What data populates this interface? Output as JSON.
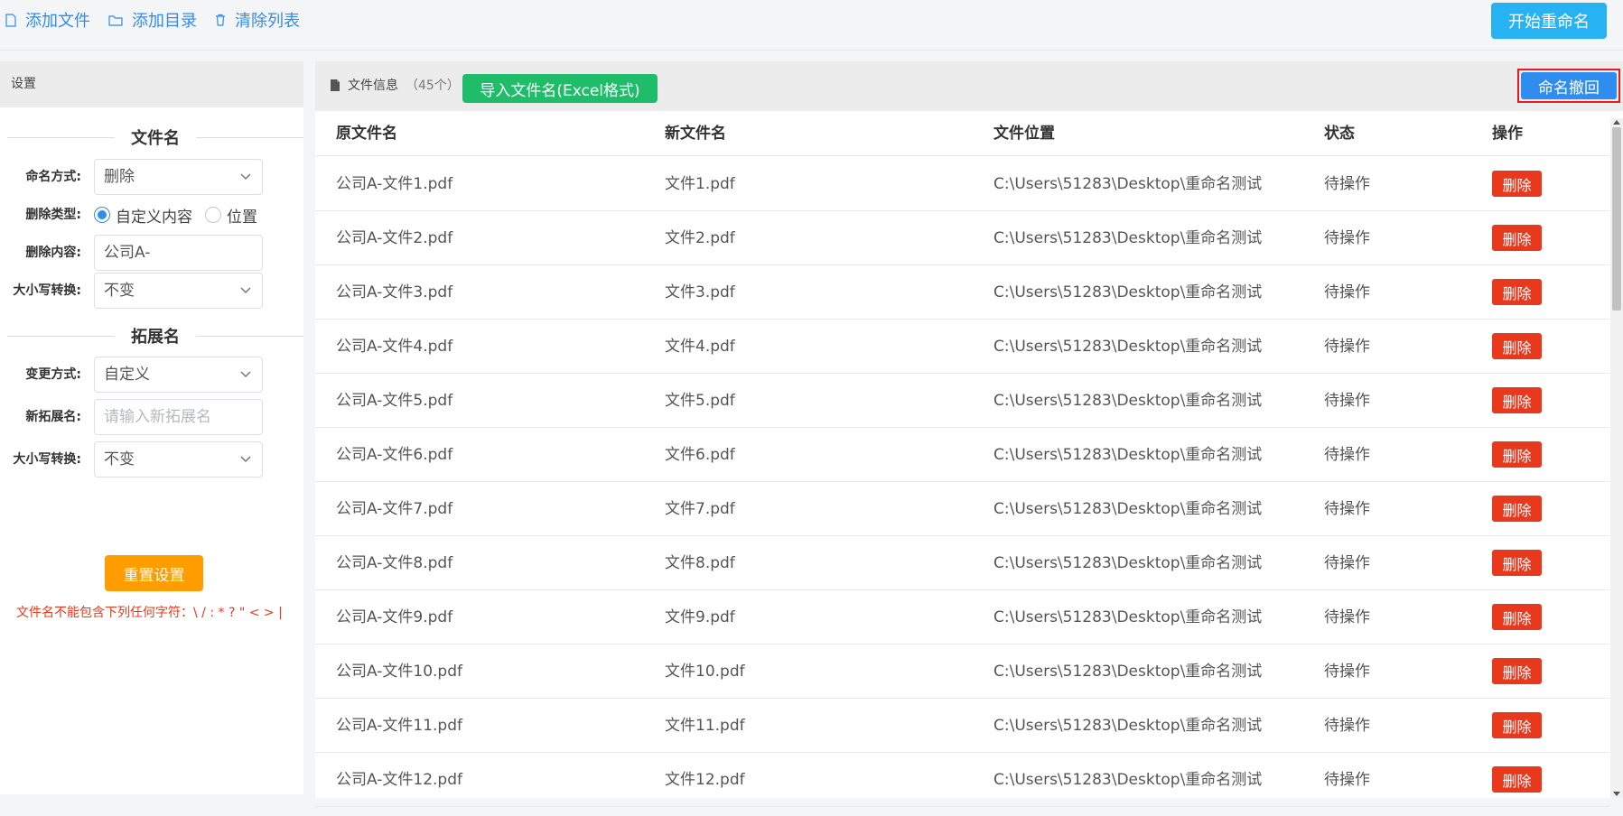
{
  "toolbar": {
    "add_file": "添加文件",
    "add_dir": "添加目录",
    "clear_list": "清除列表",
    "start_rename": "开始重命名"
  },
  "sidebar": {
    "header": "设置",
    "filename_section": "文件名",
    "extension_section": "拓展名",
    "naming_method_label": "命名方式:",
    "naming_method_value": "删除",
    "delete_type_label": "删除类型:",
    "delete_type_options": [
      "自定义内容",
      "位置"
    ],
    "delete_type_selected": "自定义内容",
    "delete_content_label": "删除内容:",
    "delete_content_value": "公司A-",
    "case_label": "大小写转换:",
    "case_value": "不变",
    "change_method_label": "变更方式:",
    "change_method_value": "自定义",
    "new_ext_label": "新拓展名:",
    "new_ext_placeholder": "请输入新拓展名",
    "ext_case_label": "大小写转换:",
    "ext_case_value": "不变",
    "reset_button": "重置设置",
    "warning": "文件名不能包含下列任何字符：\\ / : * ? \" < > |"
  },
  "main": {
    "header_label": "文件信息",
    "file_count": "（45个）",
    "import_button": "导入文件名(Excel格式)",
    "undo_button": "命名撤回",
    "columns": [
      "原文件名",
      "新文件名",
      "文件位置",
      "状态",
      "操作"
    ],
    "delete_label": "删除",
    "rows": [
      {
        "original": "公司A-文件1.pdf",
        "new": "文件1.pdf",
        "location": "C:\\Users\\51283\\Desktop\\重命名测试",
        "status": "待操作"
      },
      {
        "original": "公司A-文件2.pdf",
        "new": "文件2.pdf",
        "location": "C:\\Users\\51283\\Desktop\\重命名测试",
        "status": "待操作"
      },
      {
        "original": "公司A-文件3.pdf",
        "new": "文件3.pdf",
        "location": "C:\\Users\\51283\\Desktop\\重命名测试",
        "status": "待操作"
      },
      {
        "original": "公司A-文件4.pdf",
        "new": "文件4.pdf",
        "location": "C:\\Users\\51283\\Desktop\\重命名测试",
        "status": "待操作"
      },
      {
        "original": "公司A-文件5.pdf",
        "new": "文件5.pdf",
        "location": "C:\\Users\\51283\\Desktop\\重命名测试",
        "status": "待操作"
      },
      {
        "original": "公司A-文件6.pdf",
        "new": "文件6.pdf",
        "location": "C:\\Users\\51283\\Desktop\\重命名测试",
        "status": "待操作"
      },
      {
        "original": "公司A-文件7.pdf",
        "new": "文件7.pdf",
        "location": "C:\\Users\\51283\\Desktop\\重命名测试",
        "status": "待操作"
      },
      {
        "original": "公司A-文件8.pdf",
        "new": "文件8.pdf",
        "location": "C:\\Users\\51283\\Desktop\\重命名测试",
        "status": "待操作"
      },
      {
        "original": "公司A-文件9.pdf",
        "new": "文件9.pdf",
        "location": "C:\\Users\\51283\\Desktop\\重命名测试",
        "status": "待操作"
      },
      {
        "original": "公司A-文件10.pdf",
        "new": "文件10.pdf",
        "location": "C:\\Users\\51283\\Desktop\\重命名测试",
        "status": "待操作"
      },
      {
        "original": "公司A-文件11.pdf",
        "new": "文件11.pdf",
        "location": "C:\\Users\\51283\\Desktop\\重命名测试",
        "status": "待操作"
      },
      {
        "original": "公司A-文件12.pdf",
        "new": "文件12.pdf",
        "location": "C:\\Users\\51283\\Desktop\\重命名测试",
        "status": "待操作"
      }
    ]
  }
}
